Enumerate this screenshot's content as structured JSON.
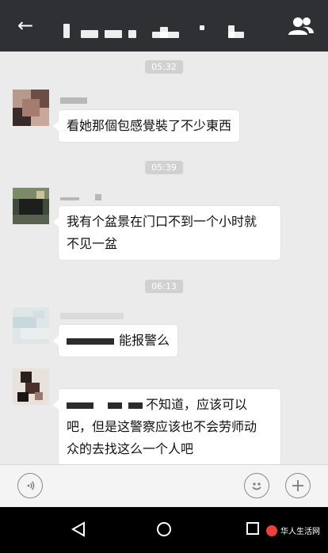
{
  "header": {
    "back_icon": "arrow-left-icon",
    "group_icon": "group-people-icon"
  },
  "messages": [
    {
      "time": "05:32",
      "text_lines": [
        "看她那個包感覺裝了不少東西"
      ]
    },
    {
      "time": "05:39",
      "text_lines": [
        "我有个盆景在门口不到一个小时就",
        "不见一盆"
      ]
    },
    {
      "time": "06:13",
      "text_lines": [
        "能报警么"
      ]
    },
    {
      "time": "",
      "text_lines": [
        "不知道，应该可以",
        "吧，但是这警察应该也不会劳师动",
        "众的去找这么一个人吧"
      ]
    }
  ],
  "input_bar": {
    "voice_icon": "voice-icon",
    "emoji_icon": "emoji-icon",
    "add_icon": "plus-icon"
  },
  "nav_bar": {
    "back_icon": "triangle-back-icon",
    "home_icon": "circle-home-icon",
    "recent_icon": "square-recent-icon"
  },
  "watermark": {
    "text": "华人生活网"
  }
}
